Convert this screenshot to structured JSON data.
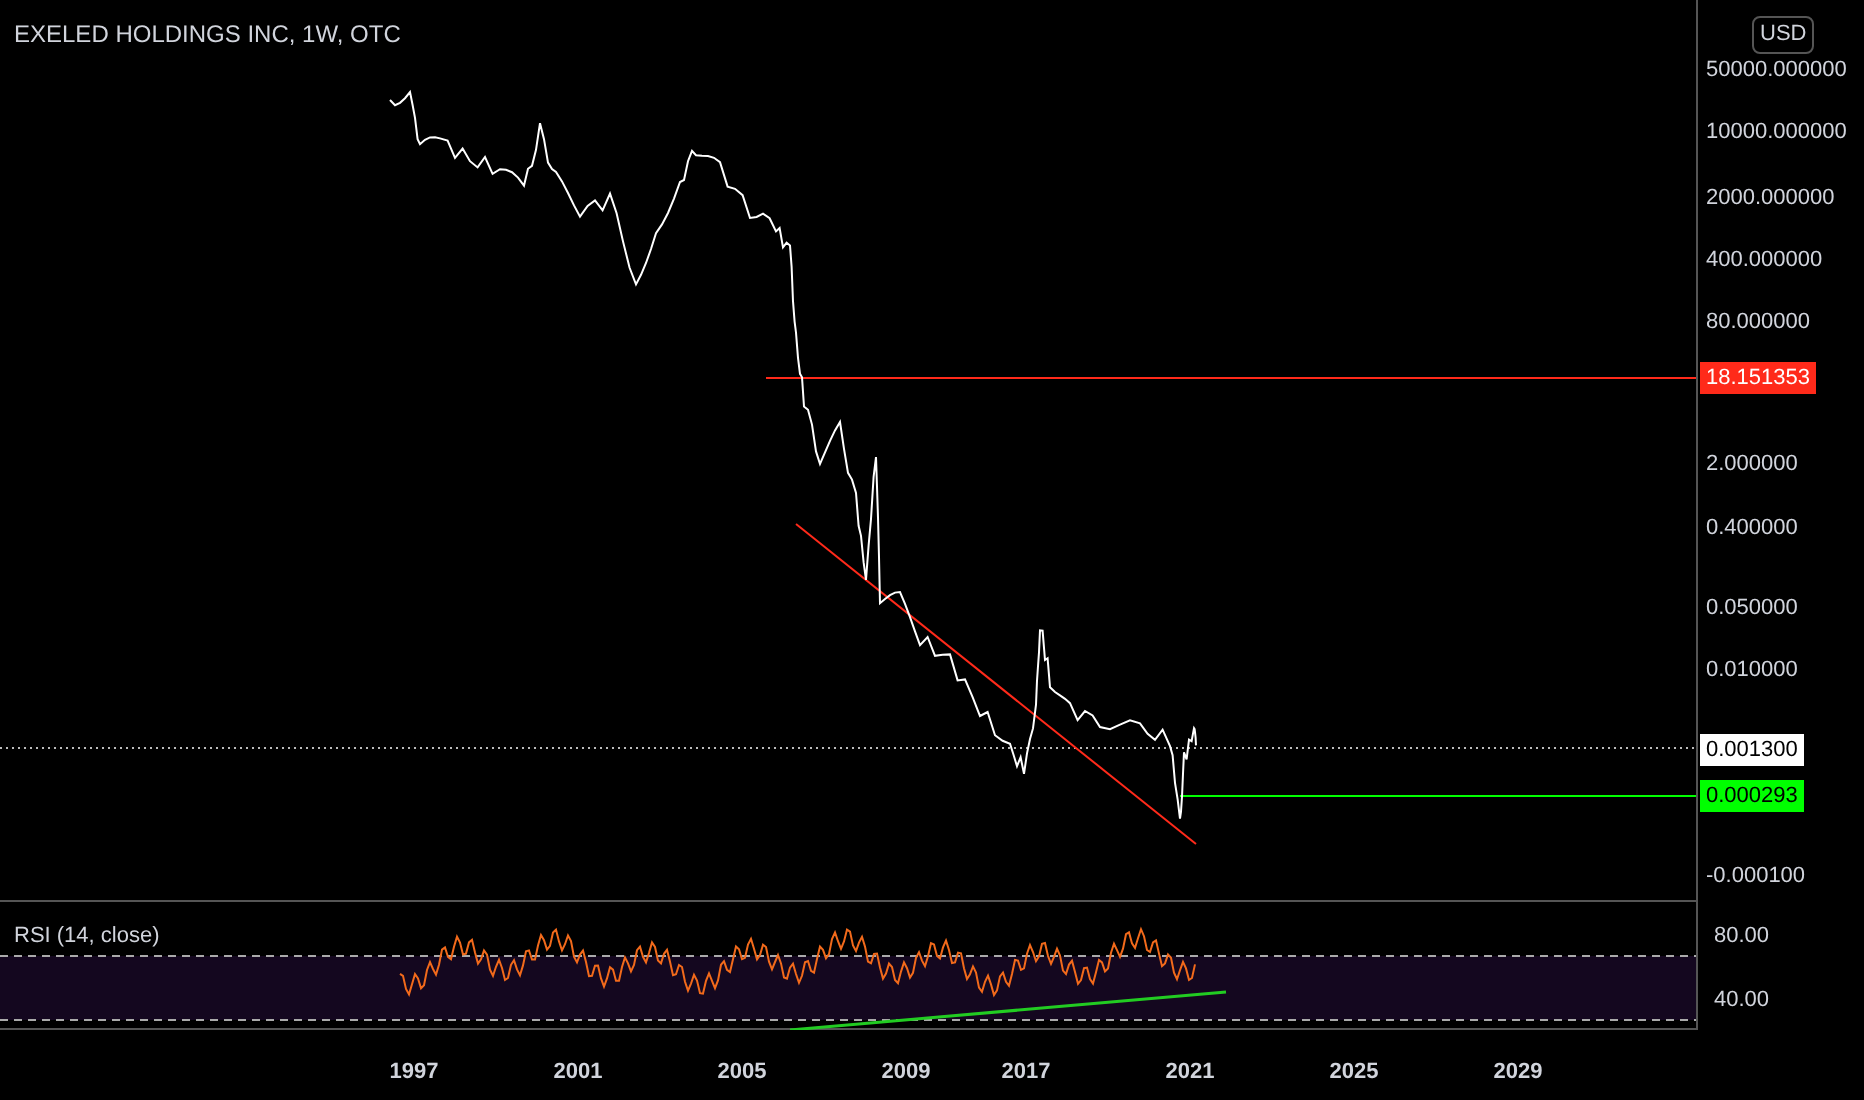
{
  "title": "EXELED HOLDINGS INC, 1W, OTC",
  "currency": "USD",
  "price_axis": [
    "50000.000000",
    "10000.000000",
    "2000.000000",
    "400.000000",
    "80.000000",
    "2.000000",
    "0.400000",
    "0.050000",
    "0.010000",
    "-0.000100"
  ],
  "price_badges": [
    {
      "label": "18.151353",
      "color": "#ff2a1a"
    },
    {
      "label": "0.001300",
      "color": "#ffffff"
    },
    {
      "label": "0.000293",
      "color": "#00ff00"
    }
  ],
  "rsi": {
    "title": "RSI (14, close)",
    "axis": [
      "80.00",
      "40.00"
    ]
  },
  "time_axis": [
    "1997",
    "2001",
    "2005",
    "2009",
    "2017",
    "2021",
    "2025",
    "2029"
  ]
}
